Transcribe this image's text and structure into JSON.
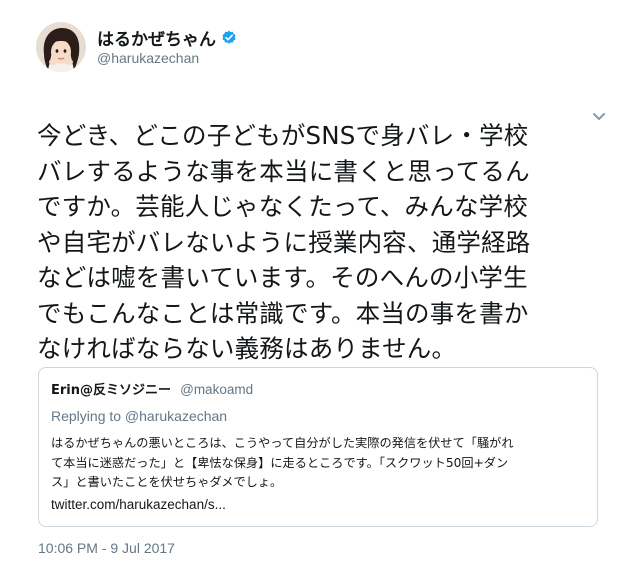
{
  "author": {
    "display_name": "はるかぜちゃん",
    "handle": "@harukazechan",
    "verified_icon": "verified-badge",
    "avatar_icon": "profile-photo"
  },
  "colors": {
    "verified": "#1da1f2",
    "secondary_text": "#657786",
    "primary_text": "#14171a",
    "card_border": "#ccd6dd"
  },
  "tweet": {
    "lines": [
      "今どき、どこの子どもがSNSで身バレ・学校",
      "バレするような事を本当に書くと思ってるん",
      "ですか。芸能人じゃなくたって、みんな学校",
      "や自宅がバレないように授業内容、通学経路",
      "などは嘘を書いています。そのへんの小学生",
      "でもこんなことは常識です。本当の事を書か",
      "なければならない義務はありません。"
    ],
    "timestamp": "10:06 PM - 9 Jul 2017",
    "menu_icon": "chevron-down"
  },
  "quoted": {
    "display_name": "Erin@反ミソジニー",
    "handle": "@makoamd",
    "replying_to": "Replying to @harukazechan",
    "lines": [
      "はるかぜちゃんの悪いところは、こうやって自分がした実際の発信を伏せて「騒がれ",
      "て本当に迷惑だった」と【卑怯な保身】に走るところです。「スクワット50回+ダン",
      "ス」と書いたことを伏せちゃダメでしょ。"
    ],
    "link": "twitter.com/harukazechan/s..."
  }
}
